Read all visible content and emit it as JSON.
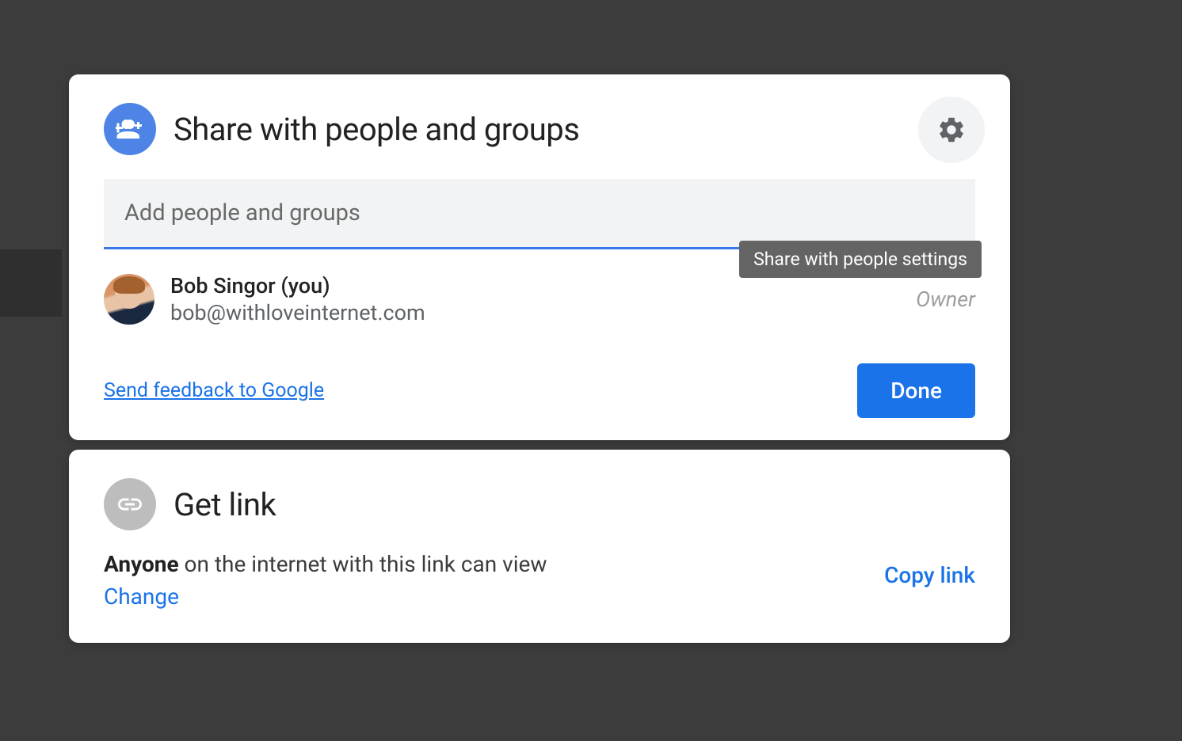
{
  "share": {
    "title": "Share with people and groups",
    "settings_tooltip": "Share with people settings",
    "add_people_placeholder": "Add people and groups",
    "people": [
      {
        "name": "Bob Singor (you)",
        "email": "bob@withloveinternet.com",
        "role": "Owner"
      }
    ],
    "feedback_link": "Send feedback to Google",
    "done_button": "Done"
  },
  "link": {
    "title": "Get link",
    "description_bold": "Anyone",
    "description_rest": " on the internet with this link can view",
    "change": "Change",
    "copy": "Copy link"
  }
}
